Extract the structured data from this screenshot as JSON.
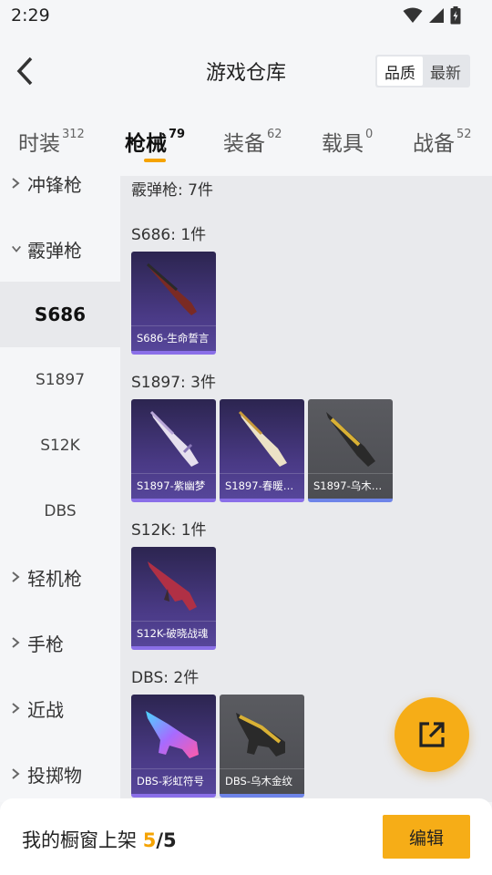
{
  "status_bar": {
    "time": "2:29"
  },
  "header": {
    "title": "游戏仓库",
    "sort_options": [
      "品质",
      "最新"
    ],
    "sort_active": "品质"
  },
  "tabs": [
    {
      "label": "时装",
      "count": "312"
    },
    {
      "label": "枪械",
      "count": "79",
      "active": true
    },
    {
      "label": "装备",
      "count": "62"
    },
    {
      "label": "载具",
      "count": "0"
    },
    {
      "label": "战备",
      "count": "52"
    }
  ],
  "sidebar": {
    "categories": [
      {
        "label": "冲锋枪",
        "expanded": false
      },
      {
        "label": "霰弹枪",
        "expanded": true
      },
      {
        "label": "轻机枪",
        "expanded": false
      },
      {
        "label": "手枪",
        "expanded": false
      },
      {
        "label": "近战",
        "expanded": false
      },
      {
        "label": "投掷物",
        "expanded": false
      }
    ],
    "subitems": [
      {
        "label": "S686",
        "selected": true
      },
      {
        "label": "S1897"
      },
      {
        "label": "S12K"
      },
      {
        "label": "DBS"
      }
    ]
  },
  "content": {
    "category_summary": "霰弹枪: 7件",
    "groups": [
      {
        "title": "S686: 1件",
        "items": [
          {
            "name": "S686-生命誓言",
            "style": "purple",
            "icon": "shotgun-s686-icon"
          }
        ]
      },
      {
        "title": "S1897: 3件",
        "items": [
          {
            "name": "S1897-紫幽梦",
            "style": "purple",
            "icon": "shotgun-s1897-white-icon"
          },
          {
            "name": "S1897-春暖…",
            "style": "purple",
            "icon": "shotgun-s1897-cream-icon"
          },
          {
            "name": "S1897-乌木…",
            "style": "gray",
            "icon": "shotgun-s1897-gold-icon"
          }
        ]
      },
      {
        "title": "S12K: 1件",
        "items": [
          {
            "name": "S12K-破晓战魂",
            "style": "purple",
            "icon": "shotgun-s12k-icon"
          }
        ]
      },
      {
        "title": "DBS: 2件",
        "items": [
          {
            "name": "DBS-彩虹符号",
            "style": "purple",
            "icon": "shotgun-dbs-rainbow-icon"
          },
          {
            "name": "DBS-乌木金纹",
            "style": "gray",
            "icon": "shotgun-dbs-gold-icon"
          }
        ]
      }
    ]
  },
  "footer": {
    "label": "我的橱窗上架 ",
    "current": "5",
    "separator": "/",
    "total": "5",
    "edit_button": "编辑"
  },
  "colors": {
    "accent": "#f6ad17",
    "card_purple": "#4a3a86",
    "card_gray": "#515257"
  }
}
